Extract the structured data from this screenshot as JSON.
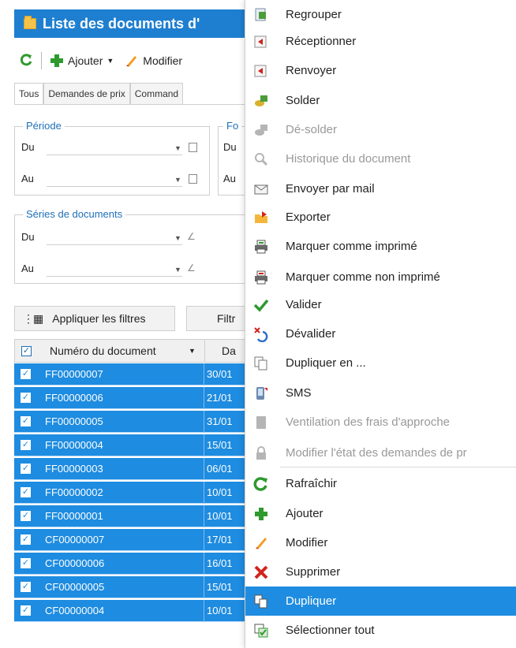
{
  "window": {
    "title": "Liste des documents d'",
    "toolbar": {
      "add_label": "Ajouter",
      "edit_label": "Modifier"
    },
    "tabs": [
      "Tous",
      "Demandes de prix",
      "Command"
    ],
    "periode": {
      "title": "Période",
      "du": "Du",
      "au": "Au"
    },
    "fo_group": {
      "title": "Fo",
      "du": "Du",
      "au": "Au"
    },
    "series": {
      "title": "Séries de documents",
      "du": "Du",
      "au": "Au"
    },
    "apply_filters_label": "Appliquer les filtres",
    "filter_label": "Filtr",
    "grid": {
      "col_number": "Numéro du document",
      "col_date": "Da",
      "rows": [
        {
          "num": "FF00000007",
          "date": "30/01"
        },
        {
          "num": "FF00000006",
          "date": "21/01"
        },
        {
          "num": "FF00000005",
          "date": "31/01"
        },
        {
          "num": "FF00000004",
          "date": "15/01"
        },
        {
          "num": "FF00000003",
          "date": "06/01"
        },
        {
          "num": "FF00000002",
          "date": "10/01"
        },
        {
          "num": "FF00000001",
          "date": "10/01"
        },
        {
          "num": "CF00000007",
          "date": "17/01"
        },
        {
          "num": "CF00000006",
          "date": "16/01"
        },
        {
          "num": "CF00000005",
          "date": "15/01"
        },
        {
          "num": "CF00000004",
          "date": "10/01"
        }
      ]
    }
  },
  "menu": {
    "items": [
      {
        "label": "Regrouper",
        "icon": "group-icon",
        "enabled": true
      },
      {
        "label": "Réceptionner",
        "icon": "receive-icon",
        "enabled": true
      },
      {
        "label": "Renvoyer",
        "icon": "return-icon",
        "enabled": true
      },
      {
        "label": "Solder",
        "icon": "settle-icon",
        "enabled": true
      },
      {
        "label": "Dé-solder",
        "icon": "unsettle-icon",
        "enabled": false
      },
      {
        "label": "Historique du document",
        "icon": "history-icon",
        "enabled": false
      },
      {
        "label": "Envoyer par mail",
        "icon": "mail-icon",
        "enabled": true
      },
      {
        "label": "Exporter",
        "icon": "export-icon",
        "enabled": true
      },
      {
        "label": "Marquer comme imprimé",
        "icon": "printer-icon",
        "enabled": true
      },
      {
        "label": "Marquer comme non imprimé",
        "icon": "printer-red-icon",
        "enabled": true
      },
      {
        "label": "Valider",
        "icon": "check-icon",
        "enabled": true
      },
      {
        "label": "Dévalider",
        "icon": "unvalidate-icon",
        "enabled": true
      },
      {
        "label": "Dupliquer en ...",
        "icon": "duplicate-as-icon",
        "enabled": true
      },
      {
        "label": "SMS",
        "icon": "sms-icon",
        "enabled": true
      },
      {
        "label": "Ventilation des frais d'approche",
        "icon": "allocation-icon",
        "enabled": false
      },
      {
        "label": "Modifier l'état des demandes de pr",
        "icon": "lock-icon",
        "enabled": false
      },
      {
        "label": "Rafraîchir",
        "icon": "refresh-icon",
        "enabled": true
      },
      {
        "label": "Ajouter",
        "icon": "add-icon",
        "enabled": true
      },
      {
        "label": "Modifier",
        "icon": "edit-icon",
        "enabled": true
      },
      {
        "label": "Supprimer",
        "icon": "delete-icon",
        "enabled": true
      },
      {
        "label": "Dupliquer",
        "icon": "duplicate-icon",
        "enabled": true,
        "selected": true
      },
      {
        "label": "Sélectionner tout",
        "icon": "select-all-icon",
        "enabled": true
      }
    ]
  },
  "colors": {
    "title_bar": "#1e7fd0",
    "selection": "#1e8ce0",
    "accent_green": "#2e9a2e",
    "delete_red": "#d0241c"
  }
}
